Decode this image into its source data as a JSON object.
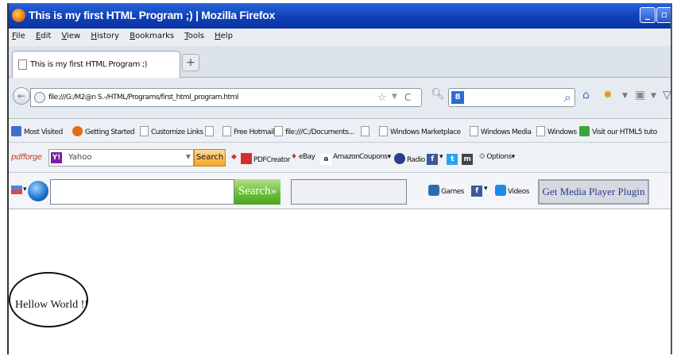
{
  "window": {
    "title": "This is my first HTML Program ;) | Mozilla Firefox",
    "minimize_glyph": "_",
    "restore_glyph": "▫"
  },
  "menu": [
    "File",
    "Edit",
    "View",
    "History",
    "Bookmarks",
    "Tools",
    "Help"
  ],
  "tabs": {
    "active_label": "This is my first HTML Program ;)",
    "new_tab_glyph": "+"
  },
  "nav": {
    "url": "file:///G:/M2@n S.-/HTML/Programs/first_html_program.html",
    "search_engine_glyph": "8",
    "search_value": "",
    "icons": [
      "home-icon",
      "sun-icon",
      "downloads-icon",
      "shield-icon"
    ]
  },
  "bookmarks": [
    {
      "label": "Most Visited",
      "icon": "gear-icon",
      "color": "#3b6fd0"
    },
    {
      "label": "Getting Started",
      "icon": "firefox-icon",
      "color": "#e36b18"
    },
    {
      "label": "Customize Links",
      "icon": "page-icon",
      "color": ""
    },
    {
      "label": "",
      "icon": "page-icon",
      "color": ""
    },
    {
      "label": "Free Hotmail",
      "icon": "page-icon",
      "color": ""
    },
    {
      "label": "file:///C:/Documents...",
      "icon": "page-icon",
      "color": ""
    },
    {
      "label": "",
      "icon": "page-icon",
      "color": ""
    },
    {
      "label": "Windows Marketplace",
      "icon": "page-icon",
      "color": ""
    },
    {
      "label": "Windows Media",
      "icon": "page-icon",
      "color": ""
    },
    {
      "label": "Windows",
      "icon": "page-icon",
      "color": ""
    },
    {
      "label": "Visit our HTML5 tuto",
      "icon": "html5-icon",
      "color": "#3aa53a"
    }
  ],
  "toolbar2": {
    "brand": "pdfforge",
    "yahoo_logo": "Y!",
    "yahoo_text": "Yahoo",
    "search_button": "Search",
    "items": [
      "PDFCreator",
      "eBay",
      "Amazon",
      "Coupons",
      "Radio",
      "Options"
    ]
  },
  "toolbar3": {
    "search_button": "Search»",
    "input_value": "",
    "games": "Games",
    "videos": "Videos",
    "media_button": "Get Media Player Plugin"
  },
  "content": {
    "text": "Hellow World !!"
  },
  "colors": {
    "titlebar": "#1a4fc8",
    "search_green": "#6bbf3a",
    "yahoo_orange": "#f5a623"
  }
}
